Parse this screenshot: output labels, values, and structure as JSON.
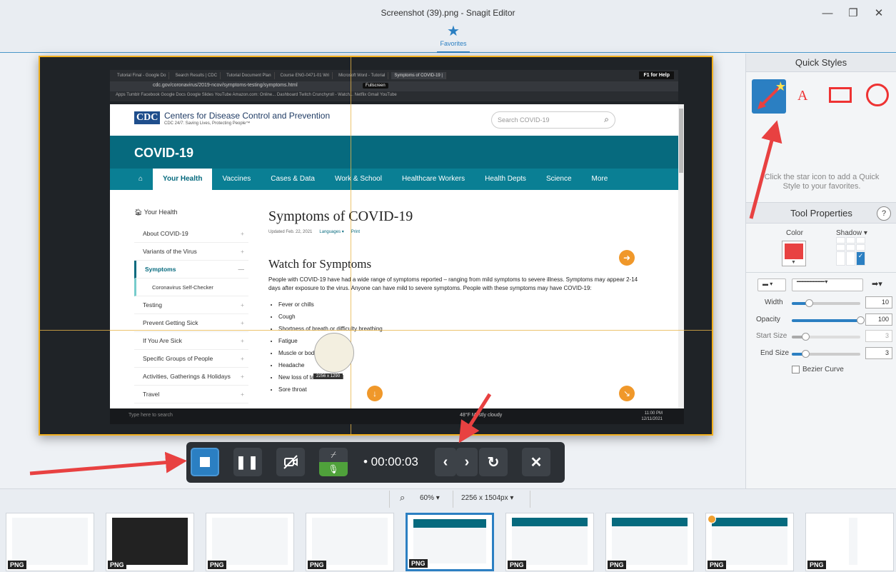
{
  "window": {
    "title": "Screenshot (39).png - Snagit Editor",
    "minimize": "—",
    "restore": "❐",
    "close": "✕"
  },
  "favorites_tab": {
    "label": "Favorites",
    "icon": "star-icon"
  },
  "screenshot": {
    "browser_tabs": [
      "Tutorial Final - Google Do",
      "Search Results | CDC",
      "Tutorial Document Plan",
      "Course ENG-0471-01 Wri",
      "Microsoft Word - Tutorial",
      "Symptoms of COVID-19 |"
    ],
    "f1_help": "F1 for Help",
    "url": "cdc.gov/coronavirus/2019-ncov/symptoms-testing/symptoms.html",
    "fullscreen": "Fullscreen",
    "bookmarks": "Apps  Tumblr  Facebook  Google Docs  Google Slides  YouTube  Amazon.com: Online...  Dashboard  Twitch  Crunchyroll - Watch...  Netflix  Gmail  YouTube",
    "cdc_logo": "CDC",
    "cdc_name": "Centers for Disease Control and Prevention",
    "cdc_tagline": "CDC 24/7: Saving Lives, Protecting People™",
    "search_placeholder": "Search COVID-19",
    "covid_title": "COVID-19",
    "nav": [
      "Your Health",
      "Vaccines",
      "Cases & Data",
      "Work & School",
      "Healthcare Workers",
      "Health Depts",
      "Science",
      "More"
    ],
    "leftnav_header": "Your Health",
    "leftnav": [
      {
        "label": "About COVID-19",
        "mark": "+"
      },
      {
        "label": "Variants of the Virus",
        "mark": "+"
      },
      {
        "label": "Symptoms",
        "mark": "—"
      },
      {
        "label": "Coronavirus Self-Checker",
        "mark": ""
      },
      {
        "label": "Testing",
        "mark": "+"
      },
      {
        "label": "Prevent Getting Sick",
        "mark": "+"
      },
      {
        "label": "If You Are Sick",
        "mark": "+"
      },
      {
        "label": "Specific Groups of People",
        "mark": "+"
      },
      {
        "label": "Activities, Gatherings & Holidays",
        "mark": "+"
      },
      {
        "label": "Travel",
        "mark": "+"
      }
    ],
    "page_title": "Symptoms of COVID-19",
    "updated": "Updated Feb. 22, 2021",
    "languages": "Languages ▾",
    "print": "Print",
    "section_title": "Watch for Symptoms",
    "paragraph": "People with COVID-19 have had a wide range of symptoms reported – ranging from mild symptoms to severe illness. Symptoms may appear 2-14 days after exposure to the virus. Anyone can have mild to severe symptoms. People with these symptoms may have COVID-19:",
    "symptoms": [
      "Fever or chills",
      "Cough",
      "Shortness of breath or difficulty breathing",
      "Fatigue",
      "Muscle or body aches",
      "Headache",
      "New loss of taste or smell",
      "Sore throat"
    ],
    "magnifier_dims": "2256 x 1290",
    "taskbar_search": "Type here to search",
    "weather": "48°F Mostly cloudy",
    "clock_time": "11:00 PM",
    "clock_date": "12/11/2021"
  },
  "recorder": {
    "timer": "• 00:00:03",
    "stop": "stop-icon",
    "pause": "pause-icon",
    "webcam": "webcam-off-icon",
    "system_audio": "system-audio-off-icon",
    "mic": "microphone-icon",
    "prev": "‹",
    "next": "›",
    "restart": "↻",
    "cancel": "✕"
  },
  "panel": {
    "quick_styles": "Quick Styles",
    "quick_styles_help": "Click the star icon to add a Quick Style to your favorites.",
    "tool_properties": "Tool Properties",
    "help": "?",
    "color_label": "Color",
    "shadow_label": "Shadow ▾",
    "width_label": "Width",
    "width_value": "10",
    "width_level": 0.25,
    "opacity_label": "Opacity",
    "opacity_value": "100",
    "opacity_level": 1.0,
    "start_size_label": "Start Size",
    "start_size_value": "3",
    "start_size_level": 0.2,
    "end_size_label": "End Size",
    "end_size_value": "3",
    "end_size_level": 0.2,
    "bezier_label": "Bezier Curve",
    "accent_color": "#e84141"
  },
  "zoombar": {
    "zoom": "60% ▾",
    "dimensions": "2256 x 1504px ▾"
  },
  "tray": {
    "badge": "PNG",
    "thumbnails": 9,
    "selected_index": 4
  },
  "colors": {
    "accent_blue": "#2b7fc2",
    "annotation_red": "#e84141",
    "cdc_teal": "#066a7e",
    "selection_border": "#f2b01e"
  }
}
